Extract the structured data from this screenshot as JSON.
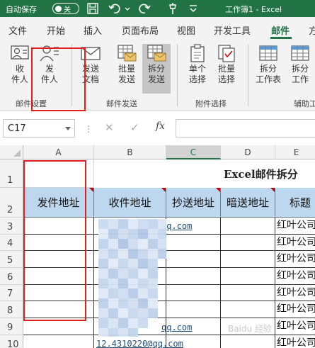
{
  "titlebar": {
    "autosave_label": "自动保存",
    "autosave_state": "关",
    "document_title": "工作簿1 - Excel"
  },
  "tabs": [
    "文件",
    "开始",
    "插入",
    "页面布局",
    "视图",
    "开发工具",
    "邮件",
    "方"
  ],
  "active_tab": "邮件",
  "ribbon": {
    "recipients": {
      "line1": "收",
      "line2": "件人"
    },
    "sender": {
      "line1": "发",
      "line2": "件人"
    },
    "send_doc": {
      "line1": "发送",
      "line2": "文档"
    },
    "batch_send": {
      "line1": "批量",
      "line2": "发送"
    },
    "split_send": {
      "line1": "拆分",
      "line2": "发送"
    },
    "single_select": {
      "line1": "单个",
      "line2": "选择"
    },
    "batch_select": {
      "line1": "批量",
      "line2": "选择"
    },
    "split_sheet": {
      "line1": "拆分",
      "line2": "工作表"
    },
    "split_workbook": {
      "line1": "拆分",
      "line2": "工作"
    },
    "groups": {
      "mail_settings": "邮件设置",
      "mail_send": "邮件发送",
      "attachment_select": "附件选择",
      "aux_tools": "辅助工"
    }
  },
  "formula_bar": {
    "name_box": "C17",
    "dots": "⋮",
    "cancel": "✕",
    "enter": "✓",
    "fx": "fx",
    "value": ""
  },
  "sheet": {
    "columns": [
      "A",
      "B",
      "C",
      "D",
      "E"
    ],
    "selected_column": "C",
    "rows": [
      "1",
      "2",
      "3",
      "4",
      "5",
      "6",
      "7",
      "8",
      "9",
      "10"
    ],
    "title": "Excel邮件拆分",
    "headers": [
      "发件地址",
      "收件地址",
      "抄送地址",
      "暗送地址",
      "标题"
    ],
    "subject_cells": [
      "红叶公司",
      "红叶公司",
      "红叶公司",
      "红叶公司",
      "红叶公司",
      "红叶公司",
      "红叶公司",
      "红叶公司"
    ],
    "visible_emails": {
      "row3": "qq.com",
      "row9": "qq.com",
      "row10": "12.4310220@qq.com"
    },
    "watermark": "Baidu 经验"
  }
}
